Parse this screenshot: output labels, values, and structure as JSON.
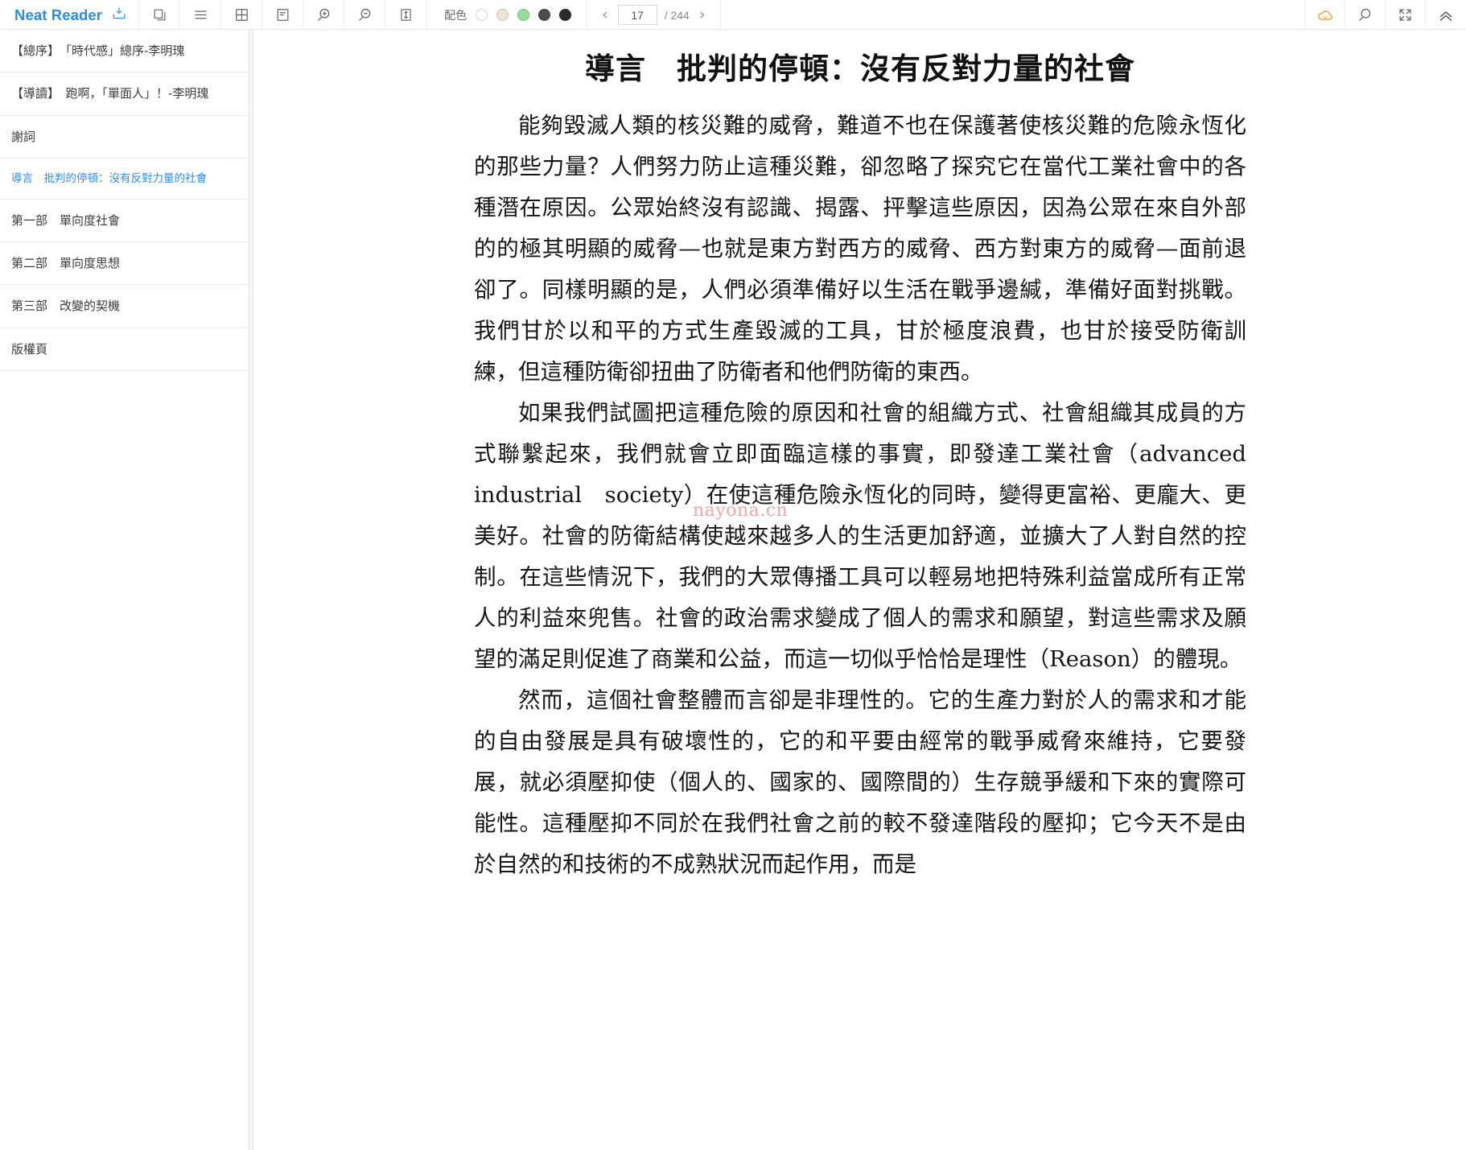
{
  "app": {
    "brand": "Neat Reader",
    "brand_icon": "bookshelf-icon"
  },
  "toolbar": {
    "left_buttons": [
      {
        "name": "copy-icon",
        "title": "复制"
      },
      {
        "name": "contents-icon",
        "title": "目录"
      },
      {
        "name": "grid-layout-icon",
        "title": "布局"
      },
      {
        "name": "notes-icon",
        "title": "笔记"
      },
      {
        "name": "zoom-in-icon",
        "title": "放大"
      },
      {
        "name": "zoom-out-icon",
        "title": "缩小"
      },
      {
        "name": "line-height-icon",
        "title": "行距"
      }
    ],
    "scheme_label": "配色",
    "scheme_swatches": [
      {
        "name": "scheme-white",
        "color": "#fdfdfd",
        "selected": false
      },
      {
        "name": "scheme-sepia",
        "color": "#eee6d2",
        "selected": false
      },
      {
        "name": "scheme-green",
        "color": "#94dd9c",
        "selected": false
      },
      {
        "name": "scheme-gray",
        "color": "#4c4c4c",
        "selected": false
      },
      {
        "name": "scheme-black",
        "color": "#2b2b2b",
        "selected": false
      }
    ],
    "pager": {
      "prev_label": "‹",
      "next_label": "›",
      "current_page": "17",
      "page_placeholder": "17",
      "total_label": "/ 244"
    },
    "right_buttons": [
      {
        "name": "cloud-sync-icon",
        "title": "云同步",
        "color": "#f0a02a"
      },
      {
        "name": "search-icon",
        "title": "搜索"
      },
      {
        "name": "fullscreen-icon",
        "title": "全屏"
      },
      {
        "name": "collapse-up-icon",
        "title": "收起"
      }
    ]
  },
  "sidebar": {
    "items": [
      {
        "label": "【總序】　「時代感」總序-李明瑰",
        "active": false
      },
      {
        "label": "【導讀】　跑啊，「單面人」！-李明瑰",
        "active": false
      },
      {
        "label": "謝詞",
        "active": false
      },
      {
        "label": "導言　批判的停頓：沒有反對力量的社會",
        "active": true
      },
      {
        "label": "第一部　單向度社會",
        "active": false
      },
      {
        "label": "第二部　單向度思想",
        "active": false
      },
      {
        "label": "第三部　改變的契機",
        "active": false
      },
      {
        "label": "版權頁",
        "active": false
      }
    ]
  },
  "content": {
    "chapter_title": "導言　批判的停頓：沒有反對力量的社會",
    "watermark": "nayona.cn",
    "paragraphs": [
      "能夠毀滅人類的核災難的威脅，難道不也在保護著使核災難的危險永恆化的那些力量？人們努力防止這種災難，卻忽略了探究它在當代工業社會中的各種潛在原因。公眾始終沒有認識、揭露、抨擊這些原因，因為公眾在來自外部的的極其明顯的威脅—也就是東方對西方的威脅、西方對東方的威脅—面前退卻了。同樣明顯的是，人們必須準備好以生活在戰爭邊緘，準備好面對挑戰。我們甘於以和平的方式生產毀滅的工具，甘於極度浪費，也甘於接受防衛訓練，但這種防衛卻扭曲了防衛者和他們防衛的東西。",
      "如果我們試圖把這種危險的原因和社會的組織方式、社會組織其成員的方式聯繫起來，我們就會立即面臨這樣的事實，即發達工業社會（advanced　industrial　society）在使這種危險永恆化的同時，變得更富裕、更龐大、更美好。社會的防衛結構使越來越多人的生活更加舒適，並擴大了人對自然的控制。在這些情況下，我們的大眾傳播工具可以輕易地把特殊利益當成所有正常人的利益來兜售。社會的政治需求變成了個人的需求和願望，對這些需求及願望的滿足則促進了商業和公益，而這一切似乎恰恰是理性（Reason）的體現。",
      "然而，這個社會整體而言卻是非理性的。它的生產力對於人的需求和才能的自由發展是具有破壞性的，它的和平要由經常的戰爭威脅來維持，它要發展，就必須壓抑使（個人的、國家的、國際間的）生存競爭緩和下來的實際可能性。這種壓抑不同於在我們社會之前的較不發達階段的壓抑；它今天不是由於自然的和技術的不成熟狀況而起作用，而是"
    ]
  }
}
